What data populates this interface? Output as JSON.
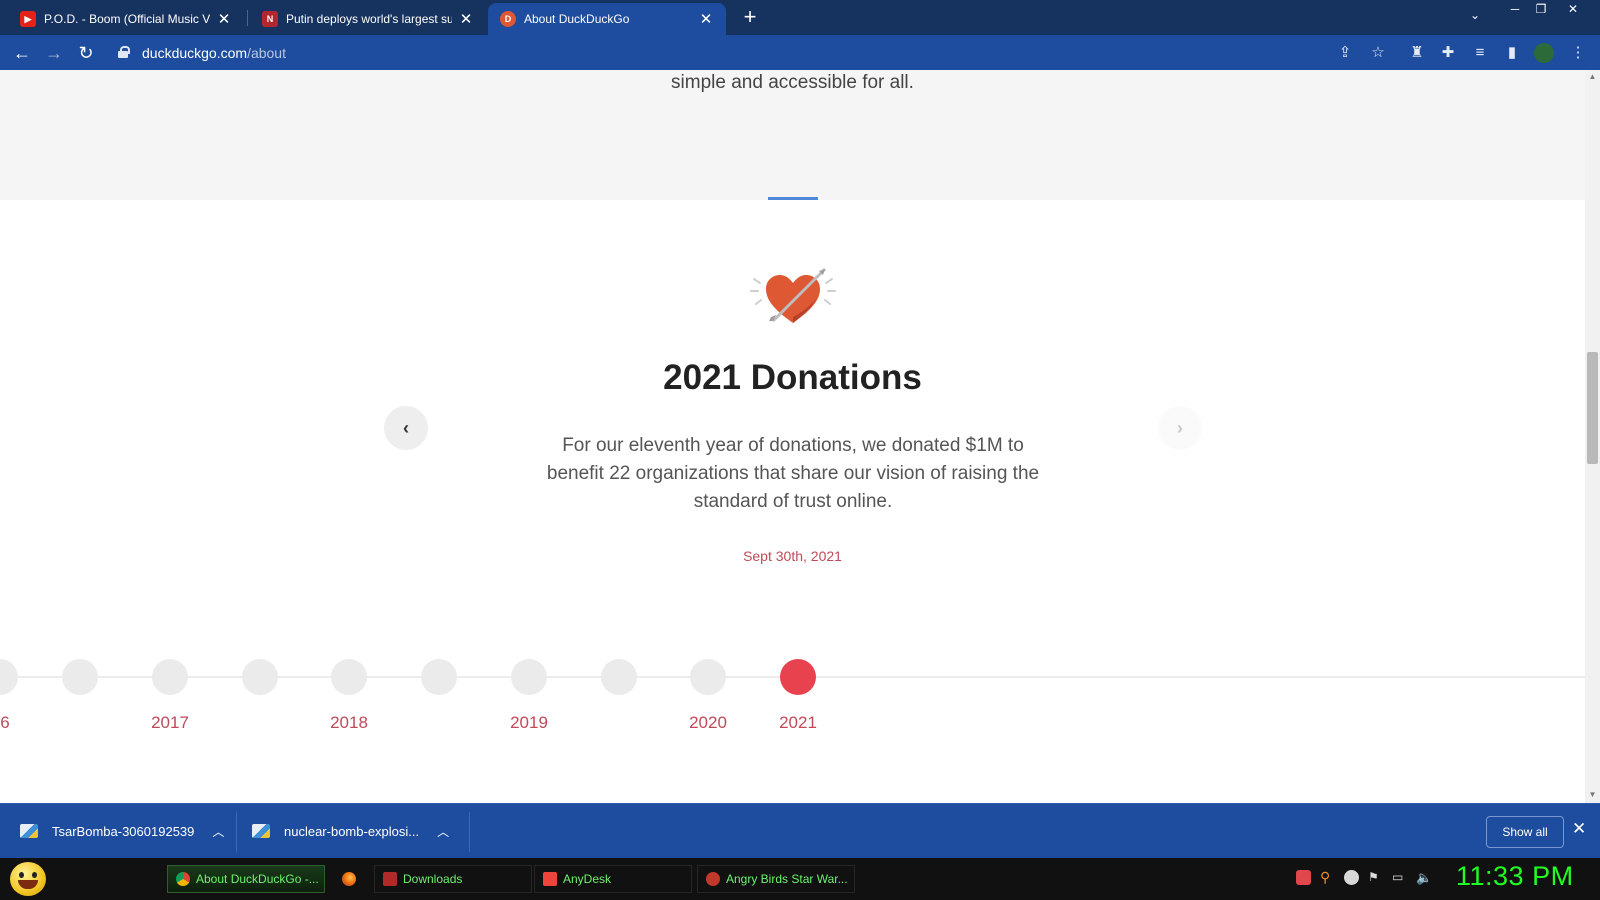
{
  "browser": {
    "tabs": [
      {
        "title": "P.O.D. - Boom (Official Music Vid",
        "favicon": "youtube-icon",
        "active": false
      },
      {
        "title": "Putin deploys world's largest sub",
        "favicon": "news-site-icon",
        "active": false
      },
      {
        "title": "About DuckDuckGo",
        "favicon": "duckduckgo-icon",
        "active": true
      }
    ],
    "new_tab_glyph": "+",
    "close_glyph": "✕",
    "address": {
      "domain": "duckduckgo.com",
      "path": "/about"
    }
  },
  "page": {
    "tagline": "simple and accessible for all.",
    "donation": {
      "title": "2021 Donations",
      "description": "For our eleventh year of donations, we donated $1M to benefit 22 organizations that share our vision of raising the standard of trust online.",
      "date": "Sept 30th, 2021"
    },
    "carousel": {
      "prev_glyph": "‹",
      "next_glyph": "›"
    },
    "timeline": {
      "years": [
        "6",
        "2017",
        "2018",
        "2019",
        "2020",
        "2021"
      ],
      "active_year": "2021"
    },
    "colors": {
      "accent": "#e8424f",
      "date_text": "#c04a5a",
      "indicator": "#4f87d9"
    }
  },
  "downloads": {
    "items": [
      {
        "name": "TsarBomba-3060192539"
      },
      {
        "name": "nuclear-bomb-explosi..."
      }
    ],
    "show_all_label": "Show all"
  },
  "taskbar": {
    "apps": [
      {
        "label": "About DuckDuckGo -...",
        "icon": "chrome-icon"
      },
      {
        "label": "",
        "icon": "firefox-icon"
      },
      {
        "label": "Downloads",
        "icon": "folder-icon"
      },
      {
        "label": "AnyDesk",
        "icon": "anydesk-icon"
      },
      {
        "label": "Angry Birds Star War...",
        "icon": "angry-birds-icon"
      }
    ],
    "clock": "11:33 PM"
  }
}
